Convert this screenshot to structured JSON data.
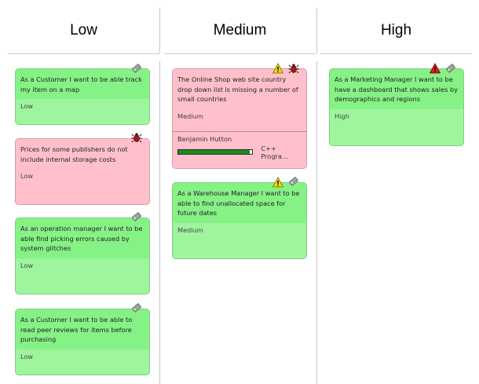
{
  "columns": [
    {
      "label": "Low"
    },
    {
      "label": "Medium"
    },
    {
      "label": "High"
    }
  ],
  "cards": {
    "low_1": {
      "title": "As a Customer I want to be able track my item on a map",
      "priority": "Low",
      "color": "green",
      "icons": [
        "tag-icon"
      ]
    },
    "low_2": {
      "title": "Prices for some publishers do not include internal storage costs",
      "priority": "Low",
      "color": "red",
      "icons": [
        "bug-icon"
      ]
    },
    "low_3": {
      "title": "As an operation manager I want to be able find picking errors caused by system glitches",
      "priority": "Low",
      "color": "green",
      "icons": [
        "tag-icon"
      ]
    },
    "low_4": {
      "title": "As a Customer I want to be able to read peer reviews for items before purchasing",
      "priority": "Low",
      "color": "green",
      "icons": [
        "tag-icon"
      ]
    },
    "med_1": {
      "title": "The Online Shop web site country drop down list is missing a number of small countries",
      "priority": "Medium",
      "assignee": "Benjamin Hutton",
      "progress": 0.97,
      "language": "C++ Progra...",
      "color": "red",
      "icons": [
        "warning-icon",
        "bug-icon"
      ]
    },
    "med_2": {
      "title": "As a Warehouse Manager I want to be able to find unallocated space for future dates",
      "priority": "Medium",
      "color": "green",
      "icons": [
        "warning-icon",
        "tag-icon"
      ]
    },
    "high_1": {
      "title": "As a Marketing Manager I want to be have a dashboard that shows sales by demographics and regions",
      "priority": "High",
      "color": "green",
      "icons": [
        "error-warning-icon",
        "tag-icon"
      ]
    }
  },
  "colors": {
    "card_green": "#9ef59e",
    "card_green_header": "#86f286",
    "card_red": "#ffc0cb",
    "progress_fill": "#1a8a1a",
    "warning_yellow": "#f5d90a",
    "error_red": "#e02020"
  }
}
